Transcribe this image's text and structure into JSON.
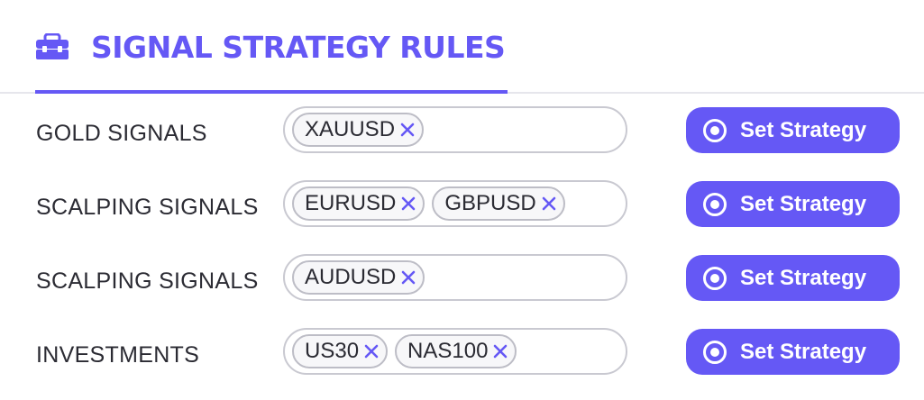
{
  "header": {
    "title": "SIGNAL STRATEGY RULES",
    "icon": "briefcase-icon"
  },
  "colors": {
    "accent": "#6558f5",
    "text": "#2b2b33",
    "border": "#c9c9d1"
  },
  "rows": [
    {
      "label": "GOLD SIGNALS",
      "tags": [
        "XAUUSD"
      ],
      "button_label": "Set Strategy"
    },
    {
      "label": "SCALPING SIGNALS",
      "tags": [
        "EURUSD",
        "GBPUSD"
      ],
      "button_label": "Set Strategy"
    },
    {
      "label": "SCALPING SIGNALS",
      "tags": [
        "AUDUSD"
      ],
      "button_label": "Set Strategy"
    },
    {
      "label": "INVESTMENTS",
      "tags": [
        "US30",
        "NAS100"
      ],
      "button_label": "Set Strategy"
    }
  ]
}
